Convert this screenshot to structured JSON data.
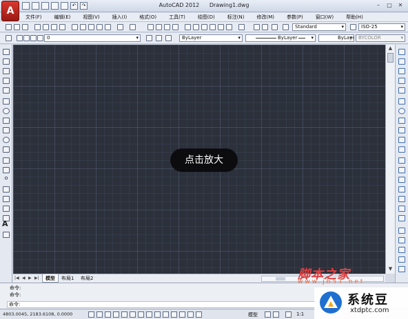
{
  "app": {
    "title": "AutoCAD 2012",
    "document": "Drawing1.dwg",
    "logo": "A"
  },
  "menu": {
    "items": [
      "文件(F)",
      "编辑(E)",
      "视图(V)",
      "插入(I)",
      "格式(O)",
      "工具(T)",
      "绘图(D)",
      "标注(N)",
      "修改(M)",
      "参数(P)",
      "窗口(W)",
      "帮助(H)"
    ]
  },
  "toolbar": {
    "text_style": "Standard",
    "dim_style": "ISO-25",
    "layer": "0",
    "color": "ByLayer",
    "linetype": "ByLayer",
    "lineweight": "ByLayer",
    "plotstyle": "BYCOLOR"
  },
  "canvas": {
    "zoom_hint": "点击放大",
    "background": "#2b303b"
  },
  "tabs": {
    "items": [
      "模型",
      "布局1",
      "布局2"
    ],
    "active": "模型"
  },
  "command": {
    "history": [
      "命令:",
      "命令:"
    ],
    "prompt": "命令:"
  },
  "status": {
    "coords": "4803.0045, 2183.6108, 0.0000",
    "model": "模型",
    "scale": "1:1"
  },
  "watermarks": {
    "site1": "脚本之家",
    "site1_url": "www.jb51.net",
    "site2": "系统豆",
    "site2_url": "xtdptc.com"
  }
}
